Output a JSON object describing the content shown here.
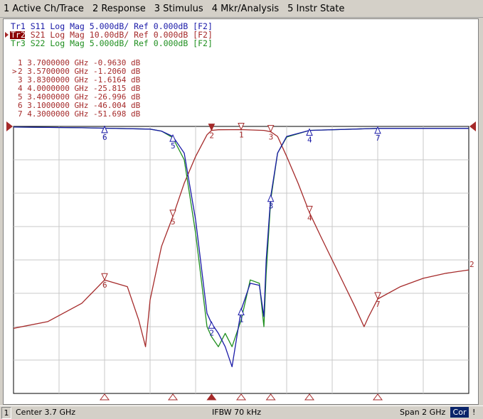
{
  "menu": {
    "items": [
      "1 Active Ch/Trace",
      "2 Response",
      "3 Stimulus",
      "4 Mkr/Analysis",
      "5 Instr State"
    ]
  },
  "trace_header": [
    {
      "text": "Tr1 S11 Log Mag 5.000dB/ Ref 0.000dB [F2]",
      "color": "#1a1aa8",
      "active": false
    },
    {
      "text": "Tr2 S21 Log Mag 10.00dB/ Ref 0.000dB [F2]",
      "color": "#a52a2a",
      "active": true
    },
    {
      "text": "Tr3 S22 Log Mag 5.000dB/ Ref 0.000dB [F2]",
      "color": "#1f8f1f",
      "active": false
    }
  ],
  "marker_table": [
    {
      "id": "1",
      "freq": "3.7000000 GHz",
      "value": "-0.9630 dB",
      "active": false
    },
    {
      "id": "2",
      "freq": "3.5700000 GHz",
      "value": "-1.2060 dB",
      "active": true
    },
    {
      "id": "3",
      "freq": "3.8300000 GHz",
      "value": "-1.6164 dB",
      "active": false
    },
    {
      "id": "4",
      "freq": "4.0000000 GHz",
      "value": "-25.815 dB",
      "active": false
    },
    {
      "id": "5",
      "freq": "3.4000000 GHz",
      "value": "-26.996 dB",
      "active": false
    },
    {
      "id": "6",
      "freq": "3.1000000 GHz",
      "value": "-46.004 dB",
      "active": false
    },
    {
      "id": "7",
      "freq": "4.3000000 GHz",
      "value": "-51.698 dB",
      "active": false
    }
  ],
  "status": {
    "channel": "1",
    "center": "Center 3.7 GHz",
    "ifbw": "IFBW 70 kHz",
    "span": "Span 2 GHz",
    "cor": "Cor",
    "end": "!"
  },
  "colors": {
    "s11": "#1a1aa8",
    "s21": "#a52a2a",
    "s22": "#1f8f1f",
    "grid": "#c8c8c8"
  },
  "chart_data": {
    "type": "line",
    "x_unit": "GHz",
    "xlim": [
      2.7,
      4.7
    ],
    "grid": true,
    "x_divisions": 10,
    "y_divisions": 8,
    "series": [
      {
        "name": "S21",
        "scale_db_per_div": 10,
        "ref_db": 0,
        "ylim": [
          -80,
          0
        ],
        "x": [
          2.7,
          2.85,
          3.0,
          3.1,
          3.2,
          3.25,
          3.28,
          3.3,
          3.35,
          3.4,
          3.45,
          3.5,
          3.55,
          3.57,
          3.6,
          3.7,
          3.8,
          3.83,
          3.86,
          3.9,
          3.95,
          4.0,
          4.05,
          4.1,
          4.15,
          4.2,
          4.24,
          4.26,
          4.3,
          4.4,
          4.5,
          4.6,
          4.7
        ],
        "y": [
          -60.5,
          -58.5,
          -53,
          -46,
          -48,
          -58,
          -66,
          -52,
          -36,
          -27,
          -17,
          -9,
          -2.5,
          -1.2,
          -1.0,
          -0.96,
          -1.2,
          -1.6,
          -3,
          -9,
          -17,
          -25.8,
          -33,
          -40,
          -47,
          -54,
          -60,
          -57,
          -51.7,
          -48,
          -45.5,
          -44,
          -43
        ]
      },
      {
        "name": "S11",
        "scale_db_per_div": 5,
        "ref_db": 0,
        "ylim": [
          -40,
          0
        ],
        "x": [
          2.7,
          3.0,
          3.3,
          3.35,
          3.4,
          3.45,
          3.5,
          3.55,
          3.57,
          3.6,
          3.63,
          3.66,
          3.7,
          3.74,
          3.78,
          3.8,
          3.81,
          3.83,
          3.86,
          3.9,
          4.0,
          4.3,
          4.7
        ],
        "y": [
          -0.1,
          -0.2,
          -0.4,
          -0.7,
          -1.5,
          -4,
          -14,
          -28,
          -29.5,
          -31,
          -33,
          -36,
          -27.5,
          -23.5,
          -23.8,
          -28.5,
          -20,
          -10.5,
          -4,
          -1.5,
          -0.6,
          -0.3,
          -0.3
        ]
      },
      {
        "name": "S22",
        "scale_db_per_div": 5,
        "ref_db": 0,
        "ylim": [
          -40,
          0
        ],
        "x": [
          2.7,
          3.0,
          3.3,
          3.35,
          3.4,
          3.45,
          3.5,
          3.55,
          3.57,
          3.6,
          3.63,
          3.66,
          3.7,
          3.74,
          3.78,
          3.8,
          3.81,
          3.83,
          3.86,
          3.9,
          4.0,
          4.3,
          4.7
        ],
        "y": [
          -0.1,
          -0.2,
          -0.4,
          -0.7,
          -1.7,
          -5,
          -16,
          -30,
          -31.5,
          -33,
          -31,
          -33,
          -29,
          -23,
          -23.5,
          -30,
          -22,
          -11,
          -4,
          -1.6,
          -0.6,
          -0.3,
          -0.3
        ]
      }
    ],
    "markers": [
      {
        "id": "1",
        "x": 3.7,
        "s21": -0.963,
        "s11": -27.5
      },
      {
        "id": "2",
        "x": 3.57,
        "s21": -1.206,
        "s11": -29.5
      },
      {
        "id": "3",
        "x": 3.83,
        "s21": -1.6164,
        "s11": -10.5
      },
      {
        "id": "4",
        "x": 4.0,
        "s21": -25.815,
        "s11": -0.6
      },
      {
        "id": "5",
        "x": 3.4,
        "s21": -26.996,
        "s11": -1.5
      },
      {
        "id": "6",
        "x": 3.1,
        "s21": -46.004,
        "s11": -0.2
      },
      {
        "id": "7",
        "x": 4.3,
        "s21": -51.698,
        "s11": -0.3
      }
    ]
  }
}
